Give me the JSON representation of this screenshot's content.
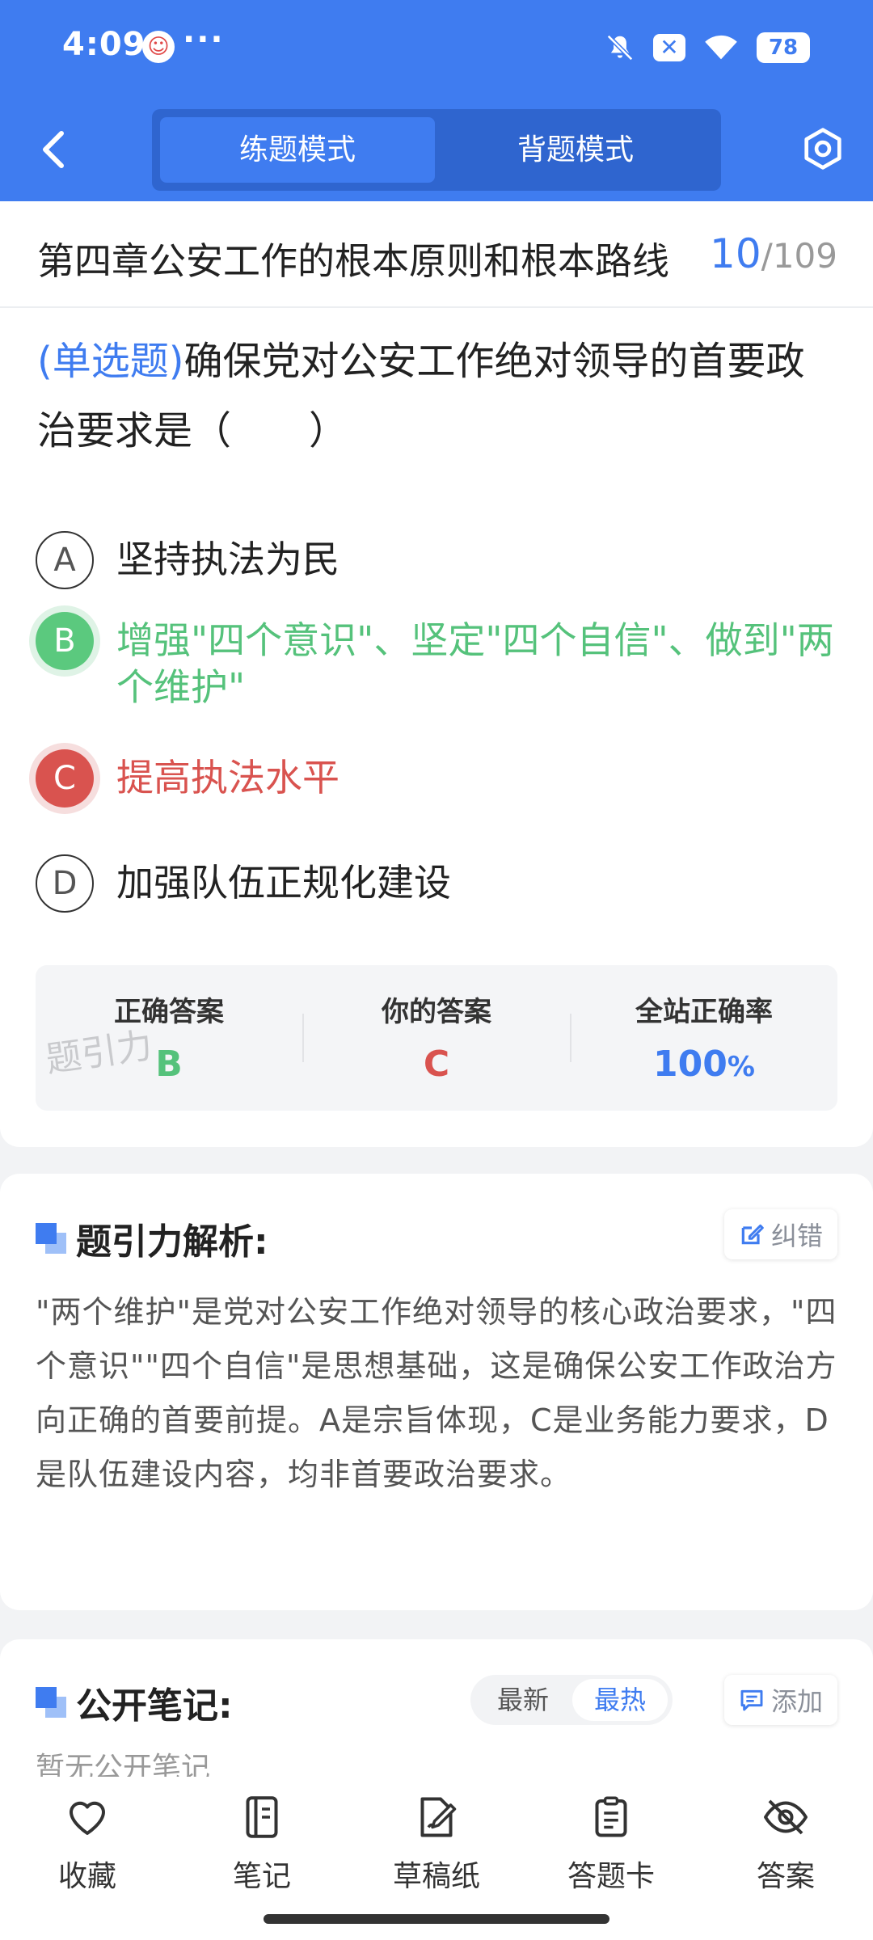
{
  "status_bar": {
    "time": "4:09",
    "dots": "···",
    "battery": "78"
  },
  "header": {
    "tabs": [
      {
        "label": "练题模式",
        "active": true
      },
      {
        "label": "背题模式",
        "active": false
      }
    ]
  },
  "chapter": {
    "title": "第四章公安工作的根本原则和根本路线",
    "current": "10",
    "separator": "/",
    "total": "109"
  },
  "question": {
    "type_label": "(单选题)",
    "text": "确保党对公安工作绝对领导的首要政治要求是（　　）"
  },
  "options": [
    {
      "letter": "A",
      "text": "坚持执法为民",
      "state": "normal"
    },
    {
      "letter": "B",
      "text": "增强\"四个意识\"、坚定\"四个自信\"、做到\"两个维护\"",
      "state": "correct"
    },
    {
      "letter": "C",
      "text": "提高执法水平",
      "state": "wrong"
    },
    {
      "letter": "D",
      "text": "加强队伍正规化建设",
      "state": "normal"
    }
  ],
  "answer_summary": {
    "correct_label": "正确答案",
    "correct_value": "B",
    "yours_label": "你的答案",
    "yours_value": "C",
    "rate_label": "全站正确率",
    "rate_value": "100",
    "rate_unit": "%",
    "watermark": "题引力"
  },
  "analysis": {
    "title": "题引力解析:",
    "report_label": "纠错",
    "text": "\"两个维护\"是党对公安工作绝对领导的核心政治要求，\"四个意识\"\"四个自信\"是思想基础，这是确保公安工作政治方向正确的首要前提。A是宗旨体现，C是业务能力要求，D是队伍建设内容，均非首要政治要求。"
  },
  "notes": {
    "title": "公开笔记:",
    "sort_latest": "最新",
    "sort_hot": "最热",
    "add_label": "添加",
    "empty_text": "暂无公开笔记"
  },
  "bottom_nav": [
    {
      "label": "收藏",
      "icon": "heart-icon"
    },
    {
      "label": "笔记",
      "icon": "notebook-icon"
    },
    {
      "label": "草稿纸",
      "icon": "draft-icon"
    },
    {
      "label": "答题卡",
      "icon": "clipboard-icon"
    },
    {
      "label": "答案",
      "icon": "eye-off-icon"
    }
  ],
  "colors": {
    "primary": "#3f7cf0",
    "correct": "#55c27b",
    "wrong": "#d9534f"
  }
}
